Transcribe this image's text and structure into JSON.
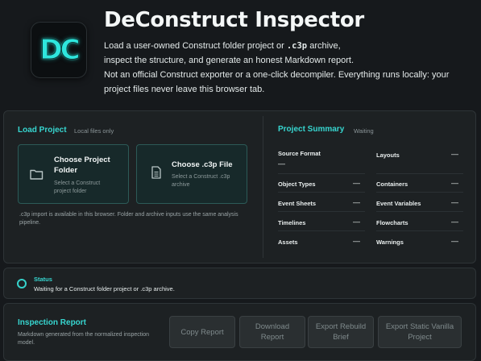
{
  "app": {
    "logo_text": "DC",
    "title": "DeConstruct Inspector",
    "intro_line1_a": "Load a user-owned Construct folder project or ",
    "intro_line1_code": ".c3p",
    "intro_line1_b": " archive,",
    "intro_line2": "inspect the structure, and generate an honest Markdown report.",
    "intro_line3": "Not an official Construct exporter or a one-click decompiler. Everything runs locally: your project files never leave this browser tab."
  },
  "load": {
    "title": "Load Project",
    "subtitle": "Local files only",
    "folder": {
      "title": "Choose Project Folder",
      "description": "Select a Construct project folder",
      "icon": "folder-icon"
    },
    "file": {
      "title": "Choose .c3p File",
      "description": "Select a Construct .c3p archive",
      "icon": "file-icon"
    },
    "note": ".c3p import is available in this browser. Folder and archive inputs use the same analysis pipeline."
  },
  "summary": {
    "title": "Project Summary",
    "state": "Waiting",
    "items": {
      "source_format": {
        "label": "Source Format",
        "value": "—"
      },
      "layouts": {
        "label": "Layouts",
        "value": "—"
      },
      "object_types": {
        "label": "Object Types",
        "value": "—"
      },
      "containers": {
        "label": "Containers",
        "value": "—"
      },
      "event_sheets": {
        "label": "Event Sheets",
        "value": "—"
      },
      "event_variables": {
        "label": "Event Variables",
        "value": "—"
      },
      "timelines": {
        "label": "Timelines",
        "value": "—"
      },
      "flowcharts": {
        "label": "Flowcharts",
        "value": "—"
      },
      "assets": {
        "label": "Assets",
        "value": "—"
      },
      "warnings": {
        "label": "Warnings",
        "value": "—"
      }
    }
  },
  "status": {
    "label": "Status",
    "text": "Waiting for a Construct folder project or .c3p archive."
  },
  "report": {
    "title": "Inspection Report",
    "subtitle": "Markdown generated from the normalized inspection model.",
    "buttons": {
      "copy": "Copy Report",
      "download": "Download Report",
      "export_rebuild": "Export Rebuild Brief",
      "export_static": "Export Static Vanilla Project"
    }
  },
  "colors": {
    "accent": "#37d6d0",
    "background": "#16191c",
    "panel": "#1d2123"
  }
}
